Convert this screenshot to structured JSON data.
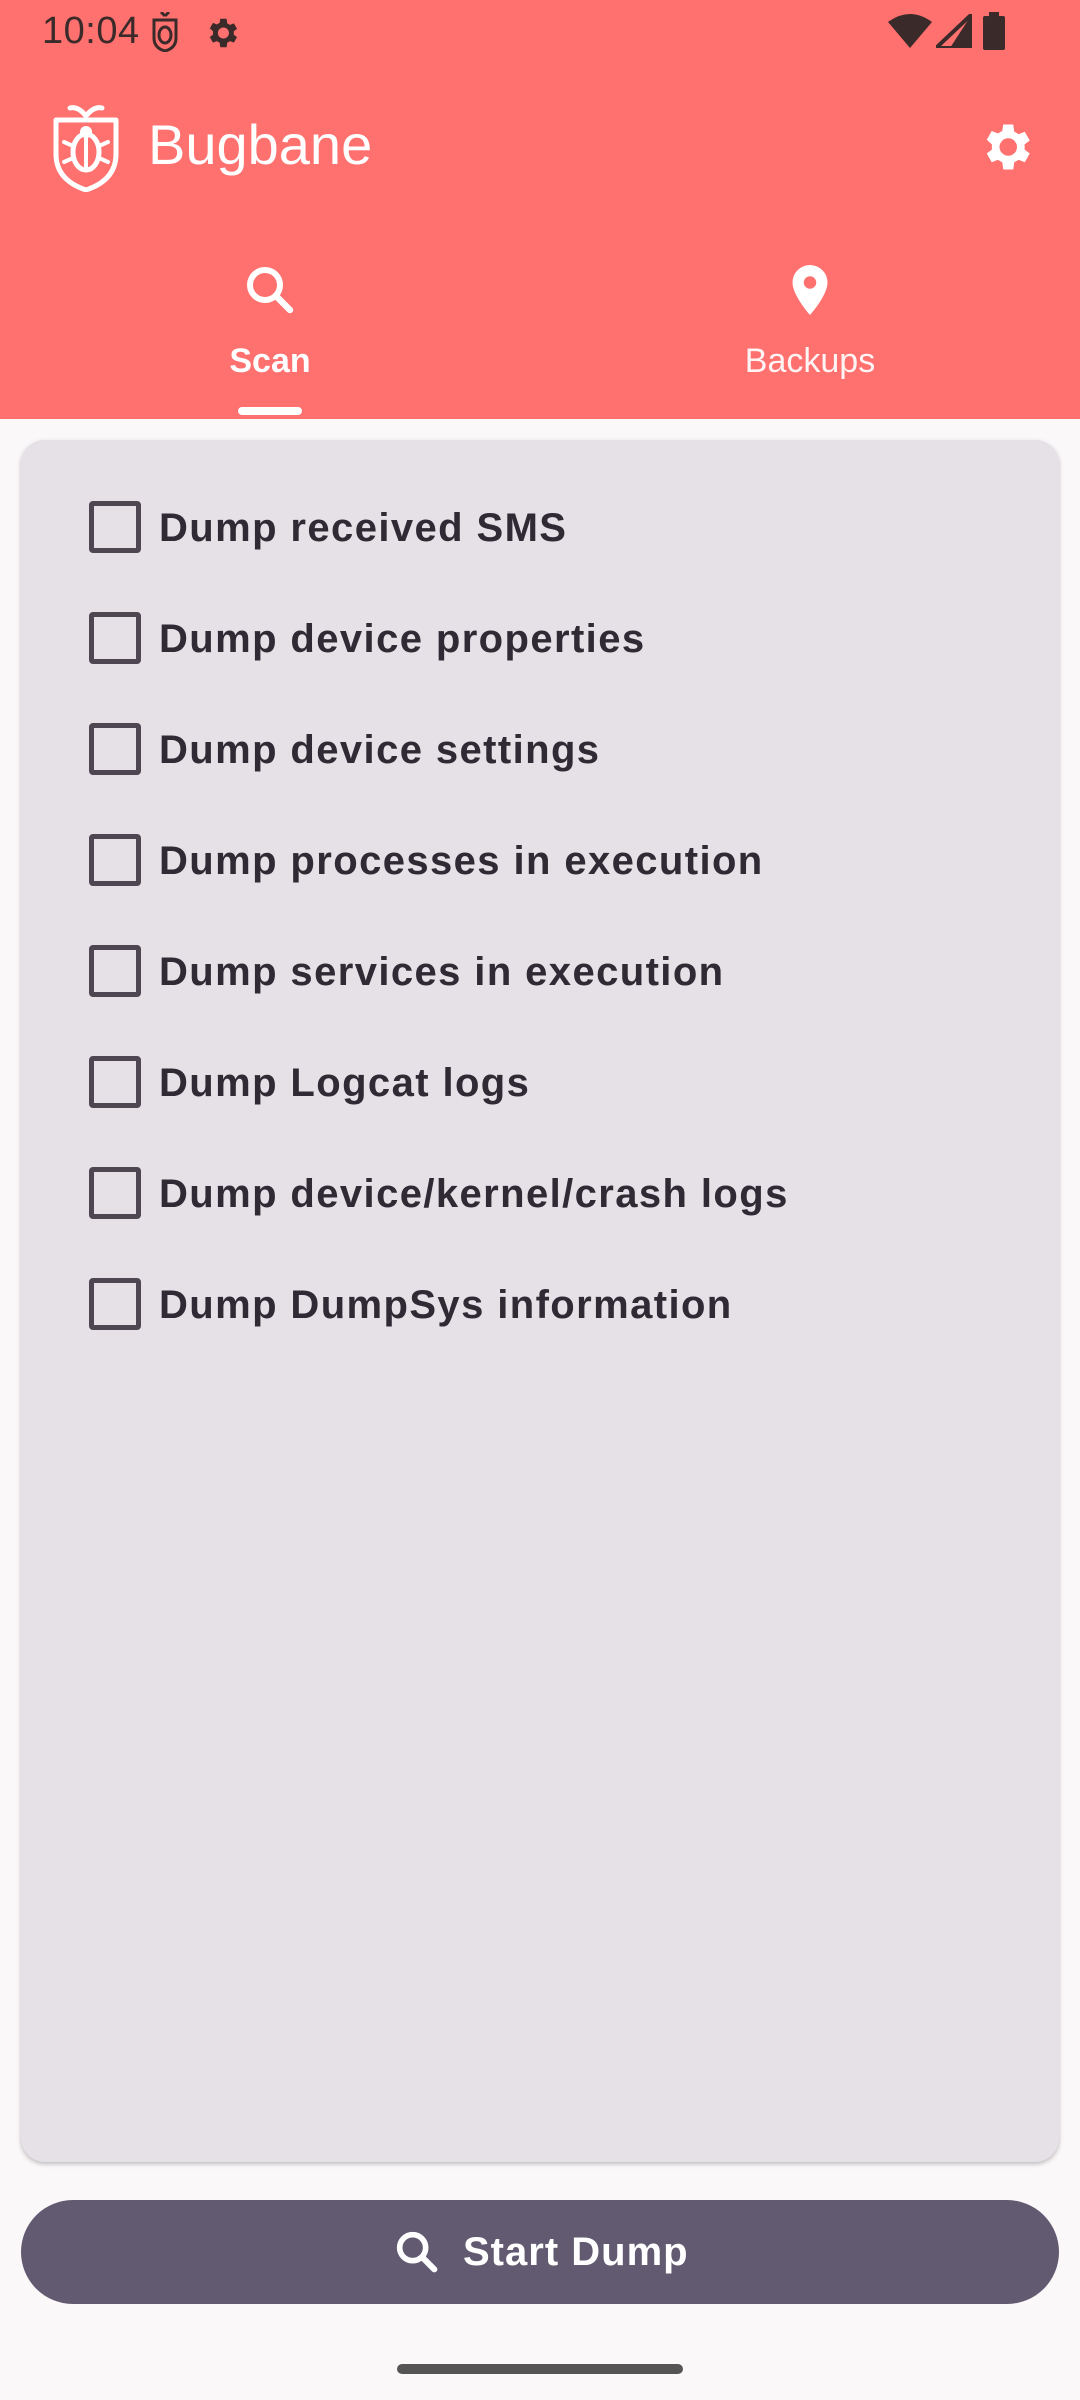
{
  "status_bar": {
    "time": "10:04",
    "left_icons": [
      "bug-notification-icon",
      "settings-notification-icon"
    ],
    "right_icons": [
      "wifi-icon",
      "signal-icon",
      "battery-icon"
    ]
  },
  "app_bar": {
    "title": "Bugbane",
    "logo_icon": "bug-shield-logo",
    "settings_icon": "gear-icon"
  },
  "tabs": [
    {
      "label": "Scan",
      "icon": "search-icon",
      "selected": true
    },
    {
      "label": "Backups",
      "icon": "location-pin-icon",
      "selected": false
    }
  ],
  "options": [
    {
      "label": "Dump received SMS",
      "checked": false
    },
    {
      "label": "Dump device properties",
      "checked": false
    },
    {
      "label": "Dump device settings",
      "checked": false
    },
    {
      "label": "Dump processes in execution",
      "checked": false
    },
    {
      "label": "Dump services in execution",
      "checked": false
    },
    {
      "label": "Dump Logcat logs",
      "checked": false
    },
    {
      "label": "Dump device/kernel/crash logs",
      "checked": false
    },
    {
      "label": "Dump DumpSys information",
      "checked": false
    }
  ],
  "start_button": {
    "label": "Start Dump",
    "icon": "search-icon"
  },
  "colors": {
    "header": "#ff716f",
    "card": "#e5e1e7",
    "button": "#625a70",
    "background": "#fbf8fa"
  }
}
